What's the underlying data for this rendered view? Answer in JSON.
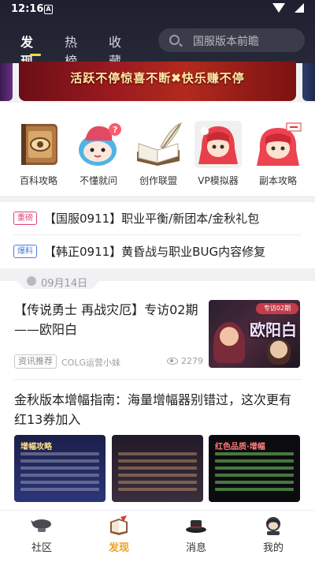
{
  "status_bar": {
    "time": "12:16",
    "sim_glyph": "A"
  },
  "header": {
    "tabs": [
      {
        "label": "发现",
        "active": true
      },
      {
        "label": "热榜",
        "active": false
      },
      {
        "label": "收藏",
        "active": false
      }
    ],
    "search": {
      "placeholder": "国服版本前瞻",
      "icon": "search-icon"
    }
  },
  "banner": {
    "text": "活跃不停惊喜不断✖快乐赚不停"
  },
  "quick_entries": [
    {
      "label": "百科攻略",
      "icon": "encyclopedia-book-icon"
    },
    {
      "label": "不懂就问",
      "icon": "ask-mascot-icon"
    },
    {
      "label": "创作联盟",
      "icon": "open-book-quill-icon"
    },
    {
      "label": "VP模拟器",
      "icon": "vp-simulator-character-icon"
    },
    {
      "label": "副本攻略",
      "icon": "dungeon-guide-character-icon"
    }
  ],
  "notices": [
    {
      "tag": "重磅",
      "tag_color": "#e0457b",
      "text": "【国服0911】职业平衡/新团本/金秋礼包"
    },
    {
      "tag": "爆料",
      "tag_color": "#4a7fe0",
      "text": "【韩正0911】黄昏战与职业BUG内容修复"
    }
  ],
  "date_chip": {
    "text": "09月14日"
  },
  "article_1": {
    "title": "【传说勇士 再战灾厄】专访02期——欧阳白",
    "tag": "资讯推荐",
    "author": "COLG运营小妹",
    "views": "2279",
    "thumb_badge": "专访02期",
    "thumb_text": "欧阳白"
  },
  "article_2": {
    "title": "金秋版本增幅指南：海量增幅器别错过，这次更有红13券加入",
    "images": [
      {
        "caption": "增幅攻略"
      },
      {
        "caption": ""
      },
      {
        "caption": "红色品质·增幅"
      }
    ]
  },
  "bottom_nav": [
    {
      "label": "社区",
      "icon": "community-airship-icon",
      "active": false
    },
    {
      "label": "发现",
      "icon": "discover-book-icon",
      "active": true
    },
    {
      "label": "消息",
      "icon": "message-hat-icon",
      "active": false
    },
    {
      "label": "我的",
      "icon": "profile-avatar-icon",
      "active": false
    }
  ],
  "colors": {
    "accent": "#f2a01b",
    "header_bg": "#1e2030",
    "tab_indicator": "#ffd54a"
  }
}
